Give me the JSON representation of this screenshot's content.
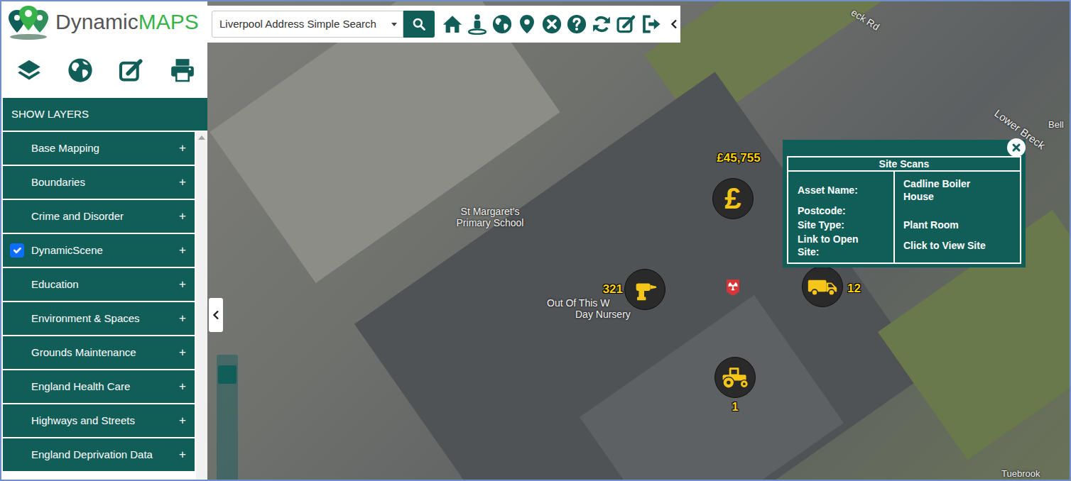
{
  "app": {
    "logo": {
      "first": "Dynamic",
      "second": "MAPS"
    }
  },
  "search": {
    "value": "Liverpool Address Simple Search"
  },
  "sidebar": {
    "header": "SHOW LAYERS",
    "layers": [
      {
        "label": "Base Mapping",
        "checked": false,
        "toggle": "+"
      },
      {
        "label": "Boundaries",
        "checked": false,
        "toggle": "+"
      },
      {
        "label": "Crime and Disorder",
        "checked": false,
        "toggle": "+"
      },
      {
        "label": "DynamicScene",
        "checked": true,
        "toggle": "+"
      },
      {
        "label": "Education",
        "checked": false,
        "toggle": "+"
      },
      {
        "label": "Environment & Spaces",
        "checked": false,
        "toggle": "+"
      },
      {
        "label": "Grounds Maintenance",
        "checked": false,
        "toggle": "+"
      },
      {
        "label": "England Health Care",
        "checked": false,
        "toggle": "+"
      },
      {
        "label": "Highways and Streets",
        "checked": false,
        "toggle": "+"
      },
      {
        "label": "England Deprivation Data",
        "checked": false,
        "toggle": "+"
      }
    ]
  },
  "map": {
    "zoom": {
      "level": 0.9
    },
    "labels": [
      {
        "text": "St Margaret's Primary School"
      },
      {
        "text": "Out Of This W"
      },
      {
        "text": "Day Nursery"
      },
      {
        "text": "eck Rd"
      },
      {
        "text": "Lower Breck"
      },
      {
        "text": "Bell"
      },
      {
        "text": "Tuebrook"
      }
    ],
    "markers": [
      {
        "kind": "cost",
        "symbol": "£",
        "label": "£45,755"
      },
      {
        "kind": "tool",
        "label": "321"
      },
      {
        "kind": "vehicle",
        "label": "12"
      },
      {
        "kind": "tractor",
        "label": "1"
      },
      {
        "kind": "hazard"
      }
    ]
  },
  "popup": {
    "title": "Site Scans",
    "rows": [
      {
        "label": "Asset Name:",
        "value": "Cadline Boiler House"
      },
      {
        "label": "Postcode:",
        "value": ""
      },
      {
        "label": "Site Type:",
        "value": "Plant Room"
      },
      {
        "label": "Link to Open Site:",
        "value": "Click to View Site"
      }
    ]
  }
}
